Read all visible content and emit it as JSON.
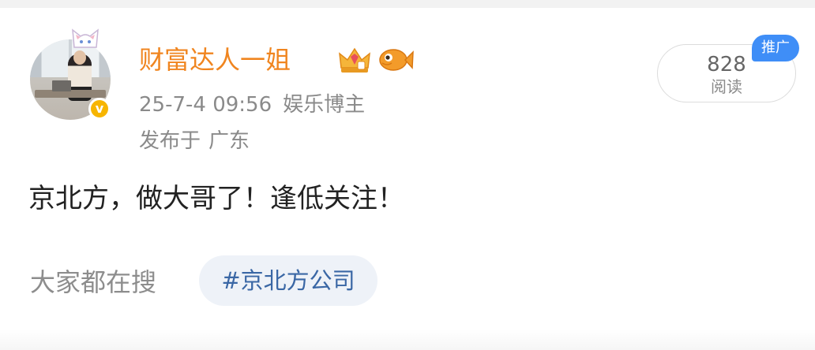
{
  "post": {
    "username": "财富达人一姐",
    "date_time": "25-7-4 09:56",
    "user_tag": "娱乐博主",
    "location_prefix": "发布于",
    "location": "广东",
    "content": "京北方，做大哥了！逢低关注！",
    "read_count": "828",
    "read_label": "阅读",
    "promo_badge": "推广",
    "verified_mark": "v"
  },
  "search": {
    "label": "大家都在搜",
    "topic": "#京北方公司"
  },
  "icons": {
    "verified": "verified-v-icon",
    "crown": "crown-badge-icon",
    "fish": "fish-badge-icon",
    "cat": "cat-avatar-frame-icon"
  },
  "colors": {
    "username": "#f0851f",
    "verified": "#f7b500",
    "promo": "#3f8ef7",
    "topic_text": "#3a67a5",
    "topic_bg": "#eef2f8"
  }
}
